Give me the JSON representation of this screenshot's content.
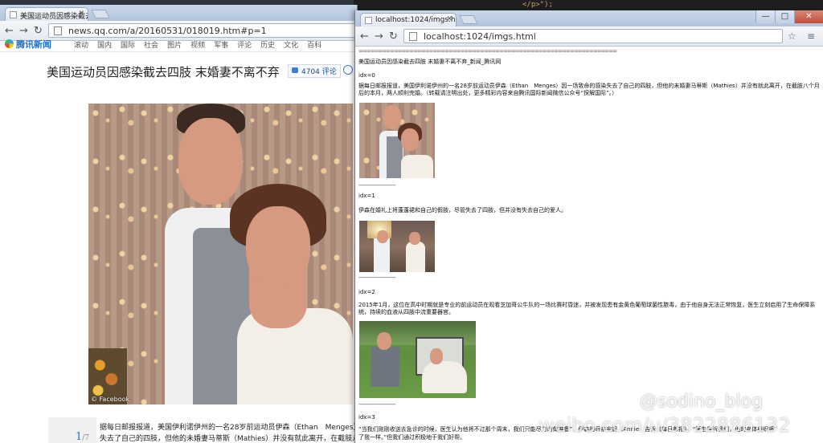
{
  "editor_strip": "</p>\");",
  "left_window": {
    "tab_title": "美国运动员因感染截去四肢",
    "url": "news.qq.com/a/20160531/018019.htm#p=1",
    "site_logo": "腾讯新闻",
    "nav_links": [
      "滚动",
      "国内",
      "国际",
      "社会",
      "图片",
      "视频",
      "军事",
      "评论",
      "历史",
      "文化",
      "百科"
    ],
    "article_title": "美国运动员因感染截去四肢 末婚妻不离不弃",
    "comment_count": "4704",
    "comment_label": "评论",
    "photo_credit": "© Facebook",
    "body_line1": "据每日邮报报道，美国伊利诺伊州的一名28岁前运动员伊森（Ethan　Menges）因一",
    "body_line2": "失去了自己的四肢，但他的未婚妻马蒂斯（Mathies）并没有就此离开，在截肢八个",
    "pager_current": "1",
    "pager_total": "/7"
  },
  "right_window": {
    "tab_title": "localhost:1024/imgs.htm",
    "url": "localhost:1024/imgs.html",
    "separator": "==================================================================",
    "page_title": "美国运动员因感染截去四肢 末婚妻不离不弃_新闻_腾讯网",
    "idx0": "idx=0",
    "para0_line1": "据每日邮报报道，美国伊利诺伊州的一名28岁前运动员伊森（Ethan　Menges）因一场致命的感染失去了自己的四肢，但他的未婚妻马蒂斯（Mathies）并没有就此离开，在截肢八个月",
    "para0_line2": "后的本月，两人顺利完婚。（转载请注明出处，更多精彩内容来自腾讯国际新闻微信公众号“探解国际”。）",
    "dash_sep": "------------------------------",
    "idx1": "idx=1",
    "para1": "伊森在婚礼上将蓬蓬裙和自己的假肢，尽管失去了四肢，但并没有失去自己的爱人。",
    "idx2": "idx=2",
    "para2_line1": "2015年1月，这位在高中时期就是专业的前运动员在观看芝加哥公牛队的一场比赛时昏迷，并被发现患有金黄色葡萄球菌性脓毒，由于他自身无法正常恢复，医生立刻启用了生命保障系",
    "para2_line2": "统，持续的血液从四肢中流重要器官。",
    "idx3": "idx=3",
    "para3_line1": "“当我们刚刚收送去急诊的时候，医生认为他将不过那个周末，我们只能尽力的做准备”，伊森的母亲安妮（Annie）告诉《每日邮报》，“医生告诉我们，他的身体组织将”",
    "para3_line2": "了我一样。”但我们通过积极地于我们好帮。"
  },
  "watermark": {
    "line1": "@sodino_blog",
    "line2": "weibo.com/u/3822886132"
  },
  "icons": {
    "back": "←",
    "forward": "→",
    "reload": "↻",
    "star": "☆",
    "wrench": "≡",
    "close": "✕",
    "minimize": "—",
    "maximize": "□"
  }
}
